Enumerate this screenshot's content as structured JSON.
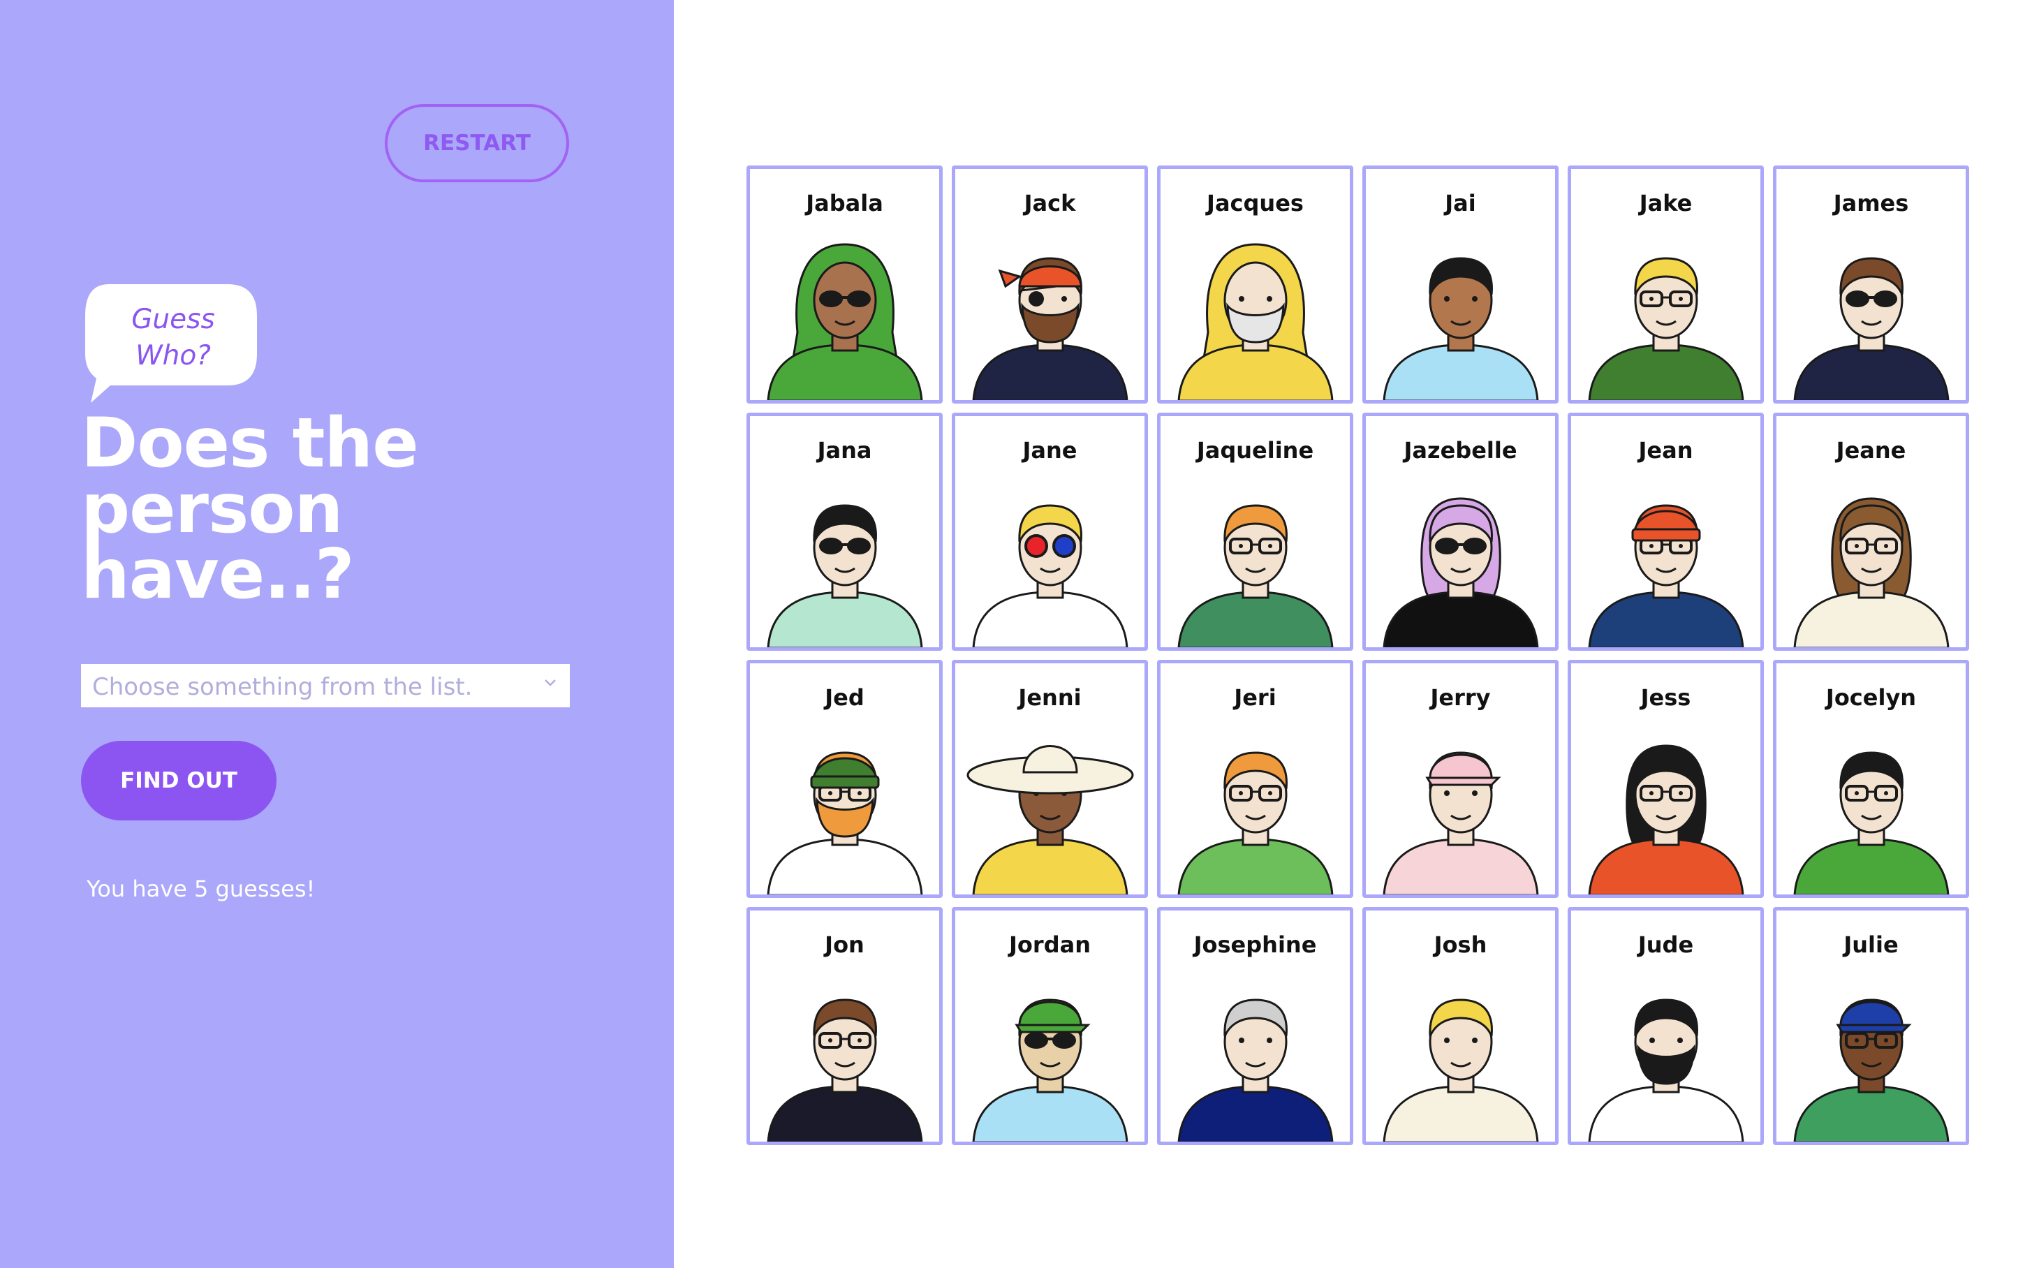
{
  "sidebar": {
    "restart_label": "RESTART",
    "bubble_line1": "Guess",
    "bubble_line2": "Who?",
    "title_line1": "Does the",
    "title_line2": "person",
    "title_line3": "have..?",
    "select_placeholder": "Choose something from the list.",
    "find_out_label": "FIND OUT",
    "guesses_text": "You have 5 guesses!"
  },
  "colors": {
    "sidebar_bg": "#aba7fa",
    "accent": "#8c55f2",
    "card_border": "#aba7fa"
  },
  "board": {
    "characters": [
      {
        "name": "Jabala",
        "skin": "#a8724f",
        "hair": "#4aa83a",
        "shirt": "#4aa83a",
        "eyewear": "sunglasses",
        "hat": "hijab",
        "hat_color": "#4aa83a"
      },
      {
        "name": "Jack",
        "skin": "#f3e2cf",
        "hair": "#7a4a2a",
        "shirt": "#1f2444",
        "eyewear": "eyepatch",
        "hat": "bandana",
        "hat_color": "#e8532a",
        "beard": "#7a4a2a"
      },
      {
        "name": "Jacques",
        "skin": "#f3e2cf",
        "hair": "#e6e6e6",
        "shirt": "#f4d64a",
        "eyewear": "none",
        "hat": "hood",
        "hat_color": "#f4d64a",
        "beard": "#e6e6e6"
      },
      {
        "name": "Jai",
        "skin": "#b3774e",
        "hair": "#1a1a1a",
        "shirt": "#a9e0f5",
        "eyewear": "none",
        "hat": "none"
      },
      {
        "name": "Jake",
        "skin": "#f3e2cf",
        "hair": "#f4d64a",
        "shirt": "#3f7f2f",
        "eyewear": "glasses",
        "hat": "none"
      },
      {
        "name": "James",
        "skin": "#f3e2cf",
        "hair": "#7a4a2a",
        "shirt": "#1f2444",
        "eyewear": "sunglasses",
        "hat": "none"
      },
      {
        "name": "Jana",
        "skin": "#f3e2cf",
        "hair": "#1a1a1a",
        "shirt": "#b5e6d0",
        "eyewear": "sunglasses",
        "hat": "none"
      },
      {
        "name": "Jane",
        "skin": "#f3e2cf",
        "hair": "#f4d64a",
        "shirt": "#ffffff",
        "eyewear": "3d-glasses",
        "hat": "none"
      },
      {
        "name": "Jaqueline",
        "skin": "#f3e2cf",
        "hair": "#ef9a3c",
        "shirt": "#3f8f5f",
        "eyewear": "glasses",
        "hat": "none"
      },
      {
        "name": "Jazebelle",
        "skin": "#f3e2cf",
        "hair": "#d6a8e6",
        "shirt": "#111111",
        "eyewear": "sunglasses",
        "hat": "none"
      },
      {
        "name": "Jean",
        "skin": "#f3e2cf",
        "hair": "#e8532a",
        "shirt": "#1d3f7a",
        "eyewear": "glasses",
        "hat": "beanie",
        "hat_color": "#e8532a"
      },
      {
        "name": "Jeane",
        "skin": "#f3e2cf",
        "hair": "#8a5a30",
        "shirt": "#f7f2e0",
        "eyewear": "glasses",
        "hat": "none"
      },
      {
        "name": "Jed",
        "skin": "#f3e2cf",
        "hair": "#ef9a3c",
        "shirt": "#ffffff",
        "eyewear": "glasses",
        "hat": "beanie",
        "hat_color": "#3f7f2f",
        "beard": "#ef9a3c"
      },
      {
        "name": "Jenni",
        "skin": "#8a5a3a",
        "hair": "#1a1a1a",
        "shirt": "#f4d64a",
        "eyewear": "none",
        "hat": "sunhat",
        "hat_color": "#f7f2e0"
      },
      {
        "name": "Jeri",
        "skin": "#f3e2cf",
        "hair": "#ef9a3c",
        "shirt": "#6cbf5a",
        "eyewear": "glasses",
        "hat": "none"
      },
      {
        "name": "Jerry",
        "skin": "#f3e2cf",
        "hair": "#f3e2cf",
        "shirt": "#f6d4d8",
        "eyewear": "none",
        "hat": "cap",
        "hat_color": "#f6c6d0"
      },
      {
        "name": "Jess",
        "skin": "#f3e2cf",
        "hair": "#1a1a1a",
        "shirt": "#e8532a",
        "eyewear": "glasses",
        "hat": "none"
      },
      {
        "name": "Jocelyn",
        "skin": "#f3e2cf",
        "hair": "#1a1a1a",
        "shirt": "#4aa83a",
        "eyewear": "glasses",
        "hat": "none"
      },
      {
        "name": "Jon",
        "skin": "#f3e2cf",
        "hair": "#7a4a2a",
        "shirt": "#1a1a2a",
        "eyewear": "glasses",
        "hat": "none"
      },
      {
        "name": "Jordan",
        "skin": "#e8d0a8",
        "hair": "#f4d64a",
        "shirt": "#a9e0f5",
        "eyewear": "sunglasses",
        "hat": "cap",
        "hat_color": "#4aa83a"
      },
      {
        "name": "Josephine",
        "skin": "#f3e2cf",
        "hair": "#cfcfcf",
        "shirt": "#0e1f7a",
        "eyewear": "none",
        "hat": "none"
      },
      {
        "name": "Josh",
        "skin": "#f3e2cf",
        "hair": "#f4d64a",
        "shirt": "#f7f2e0",
        "eyewear": "none",
        "hat": "none"
      },
      {
        "name": "Jude",
        "skin": "#f3e2cf",
        "hair": "#1a1a1a",
        "shirt": "#ffffff",
        "eyewear": "none",
        "hat": "none",
        "beard": "#1a1a1a"
      },
      {
        "name": "Julie",
        "skin": "#7a4a2a",
        "hair": "#1a1a1a",
        "shirt": "#3f9f5f",
        "eyewear": "glasses",
        "hat": "cap",
        "hat_color": "#1f3fa8"
      }
    ]
  }
}
